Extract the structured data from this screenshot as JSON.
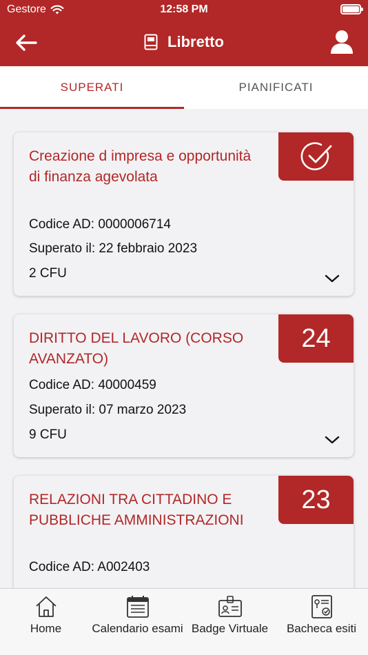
{
  "status_bar": {
    "carrier": "Gestore",
    "time": "12:58 PM"
  },
  "header": {
    "title": "Libretto",
    "back_icon": "arrow-left-icon",
    "title_icon": "book-icon",
    "profile_icon": "user-icon"
  },
  "tabs": [
    {
      "label": "SUPERATI",
      "active": true
    },
    {
      "label": "PIANIFICATI",
      "active": false
    }
  ],
  "cards": [
    {
      "title": "Creazione d impresa e opportunità di finanza agevolata",
      "code": "Codice AD: 0000006714",
      "passed": "Superato il: 22 febbraio 2023",
      "cfu": "2 CFU",
      "grade": "",
      "grade_icon": "check-circle-icon"
    },
    {
      "title": "DIRITTO DEL LAVORO (CORSO AVANZATO)",
      "code": "Codice AD: 40000459",
      "passed": "Superato il: 07 marzo 2023",
      "cfu": "9 CFU",
      "grade": "24"
    },
    {
      "title": "RELAZIONI TRA CITTADINO E PUBBLICHE AMMINISTRAZIONI",
      "code": "Codice AD: A002403",
      "grade": "23"
    }
  ],
  "bottom_nav": [
    {
      "label": "Home",
      "icon": "home-icon"
    },
    {
      "label": "Calendario esami",
      "icon": "calendar-icon"
    },
    {
      "label": "Badge Virtuale",
      "icon": "badge-icon"
    },
    {
      "label": "Bacheca esiti",
      "icon": "results-board-icon"
    }
  ],
  "colors": {
    "brand": "#b22727",
    "background": "#f2f2f4"
  }
}
